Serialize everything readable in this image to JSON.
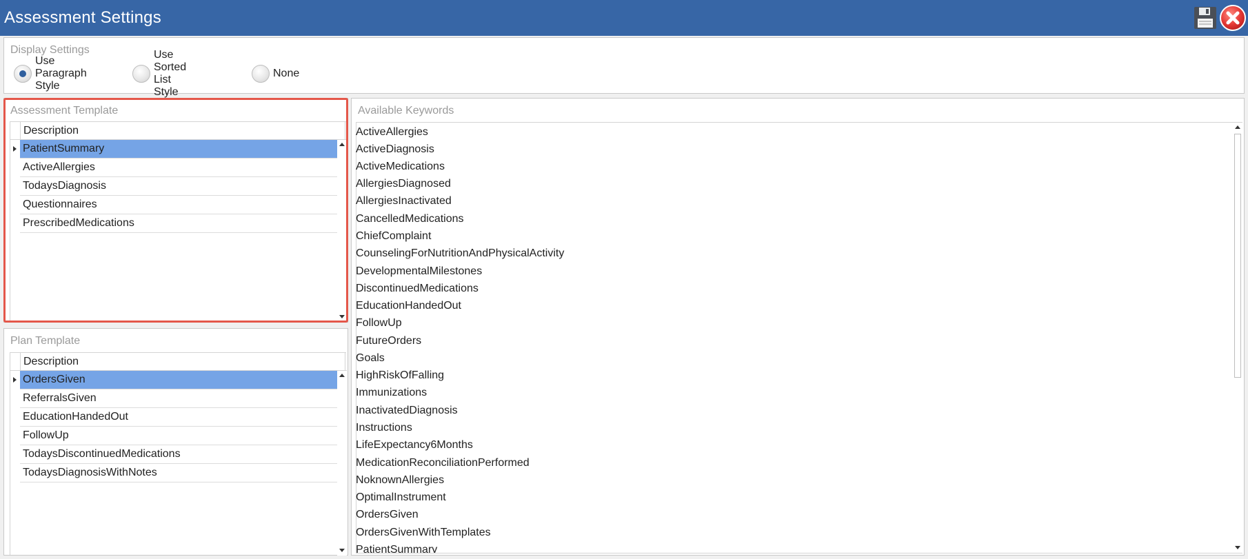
{
  "window": {
    "title": "Assessment Settings",
    "save_icon": "floppy-disk-icon",
    "close_icon": "red-x-close-icon"
  },
  "display_settings": {
    "label": "Display Settings",
    "options": [
      {
        "label": "Use Paragraph Style",
        "selected": true
      },
      {
        "label": "Use Sorted List Style",
        "selected": false
      },
      {
        "label": "None",
        "selected": false
      }
    ]
  },
  "assessment_template": {
    "label": "Assessment Template",
    "column_header": "Description",
    "rows": [
      "PatientSummary",
      "ActiveAllergies",
      "TodaysDiagnosis",
      "Questionnaires",
      "PrescribedMedications"
    ],
    "selected_index": 0
  },
  "plan_template": {
    "label": "Plan Template",
    "column_header": "Description",
    "rows": [
      "OrdersGiven",
      "ReferralsGiven",
      "EducationHandedOut",
      "FollowUp",
      "TodaysDiscontinuedMedications",
      "TodaysDiagnosisWithNotes"
    ],
    "selected_index": 0
  },
  "available_keywords": {
    "label": "Available Keywords",
    "items": [
      "ActiveAllergies",
      "ActiveDiagnosis",
      "ActiveMedications",
      "AllergiesDiagnosed",
      "AllergiesInactivated",
      "CancelledMedications",
      "ChiefComplaint",
      "CounselingForNutritionAndPhysicalActivity",
      "DevelopmentalMilestones",
      "DiscontinuedMedications",
      "EducationHandedOut",
      "FollowUp",
      "FutureOrders",
      "Goals",
      "HighRiskOfFalling",
      "Immunizations",
      "InactivatedDiagnosis",
      "Instructions",
      "LifeExpectancy6Months",
      "MedicationReconciliationPerformed",
      "NoknownAllergies",
      "OptimalInstrument",
      "OrdersGiven",
      "OrdersGivenWithTemplates",
      "PatientSummary"
    ]
  },
  "colors": {
    "titlebar": "#3766a6",
    "selection": "#75a4e6",
    "highlight_border": "#e4574a"
  }
}
